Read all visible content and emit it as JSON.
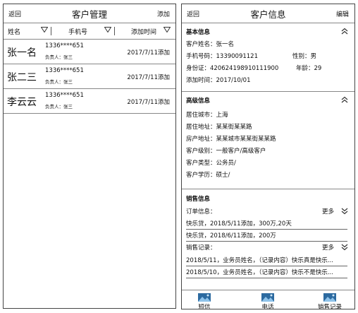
{
  "list": {
    "back_label": "返回",
    "title": "客户管理",
    "add_label": "添加",
    "filters": [
      "姓名",
      "手机号",
      "添加时间"
    ],
    "rows": [
      {
        "name": "张一名",
        "phone": "1336****651",
        "owner": "负责人：张三",
        "date": "2017/7/11添加"
      },
      {
        "name": "张二三",
        "phone": "1336****651",
        "owner": "负责人：张三",
        "date": "2017/7/11添加"
      },
      {
        "name": "李云云",
        "phone": "1336****651",
        "owner": "负责人：张三",
        "date": "2017/7/11添加"
      }
    ]
  },
  "detail": {
    "back_label": "返回",
    "title": "客户信息",
    "edit_label": "编辑",
    "basic": {
      "title": "基本信息",
      "name": "客户姓名：张一名",
      "phone": "手机号码：13390091121",
      "gender": "性别：男",
      "id_card": "身份证：420624198910111900",
      "age": "年龄：29",
      "added": "添加时间：2017/10/01"
    },
    "advanced": {
      "title": "高级信息",
      "lines": [
        "居住城市：上海",
        "居住地址：某某街某某路",
        "房产地址：某某城市某某街某某路",
        "客户级别：一般客户/高级客户",
        "客户类型：公务员/",
        "客户学历：硕士/"
      ]
    },
    "sales": {
      "title": "销售信息",
      "orders_label": "订单信息：",
      "orders_more": "更多",
      "orders": [
        "快乐贷，2018/5/11添加，300万,20天",
        "快乐贷，2018/6/11添加，200万"
      ],
      "records_label": "销售记录：",
      "records_more": "更多",
      "records": [
        "2018/5/11，业务员姓名，（记录内容）快乐真是快乐...",
        "2018/5/10，业务员姓名，（记录内容）快乐不是快乐..."
      ]
    },
    "tabs": [
      "短信",
      "电话",
      "销售记录"
    ]
  }
}
